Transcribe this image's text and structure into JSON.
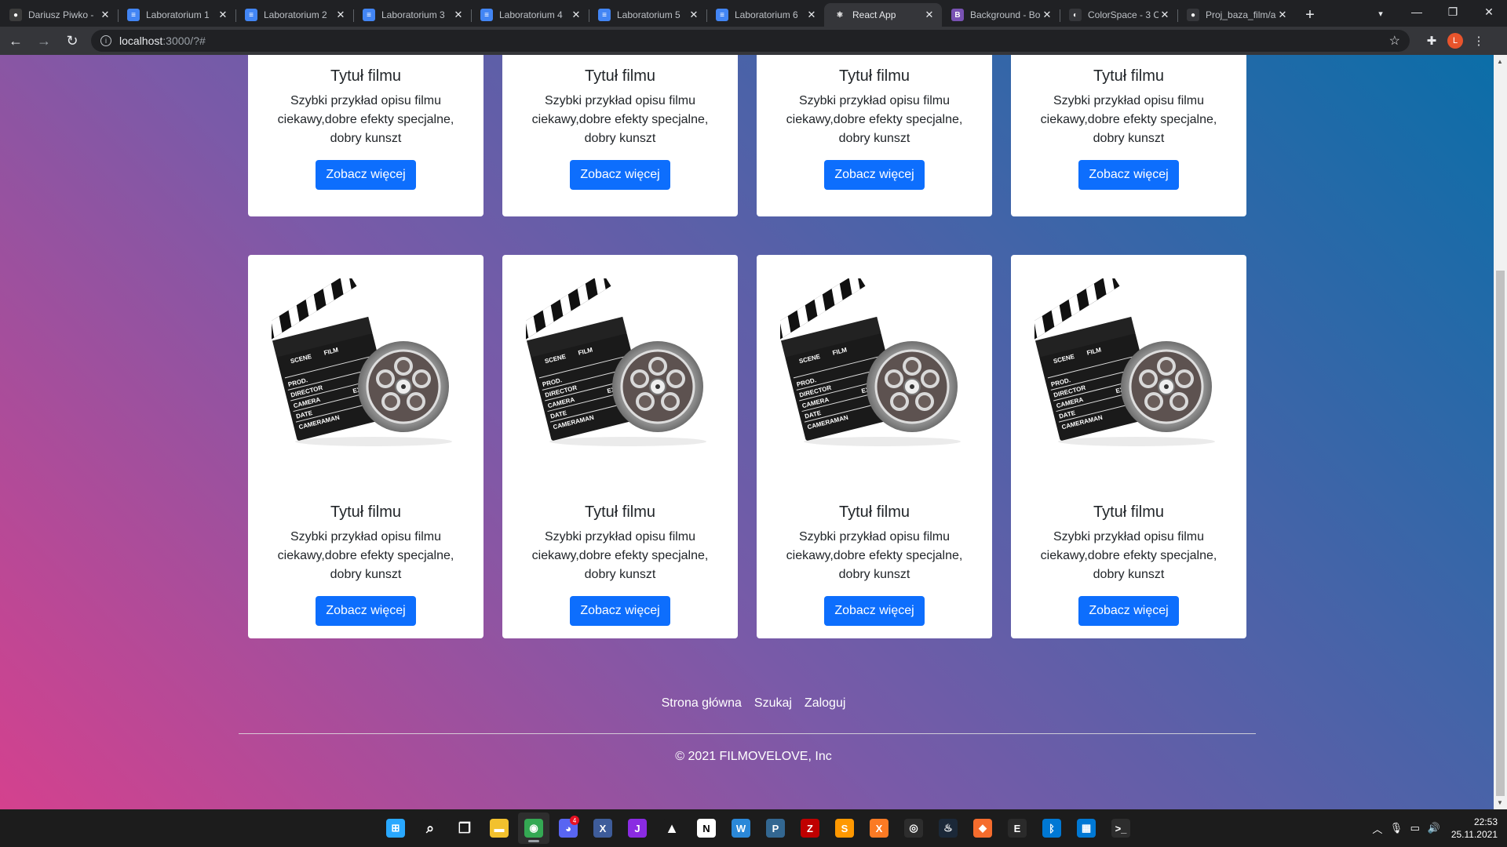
{
  "browser": {
    "tabs": [
      {
        "title": "Dariusz Piwko -",
        "favicon_color": "#3c3c3c",
        "favicon_glyph": "●"
      },
      {
        "title": "Laboratorium 1",
        "favicon_color": "#4285f4",
        "favicon_glyph": "≡"
      },
      {
        "title": "Laboratorium 2",
        "favicon_color": "#4285f4",
        "favicon_glyph": "≡"
      },
      {
        "title": "Laboratorium 3",
        "favicon_color": "#4285f4",
        "favicon_glyph": "≡"
      },
      {
        "title": "Laboratorium 4",
        "favicon_color": "#4285f4",
        "favicon_glyph": "≡"
      },
      {
        "title": "Laboratorium 5",
        "favicon_color": "#4285f4",
        "favicon_glyph": "≡"
      },
      {
        "title": "Laboratorium 6",
        "favicon_color": "#4285f4",
        "favicon_glyph": "≡"
      },
      {
        "title": "React App",
        "favicon_color": "#35363a",
        "favicon_glyph": "⚛",
        "active": true
      },
      {
        "title": "Background - Bo",
        "favicon_color": "#7952b3",
        "favicon_glyph": "B"
      },
      {
        "title": "ColorSpace - 3 C",
        "favicon_color": "#35363a",
        "favicon_glyph": "◐"
      },
      {
        "title": "Proj_baza_film/a",
        "favicon_color": "#35363a",
        "favicon_glyph": "●"
      }
    ],
    "url_host": "localhost",
    "url_path": ":3000/?#",
    "profile_initial": "L"
  },
  "cards_row1": [
    {
      "title": "Tytuł filmu",
      "description": "Szybki przykład opisu filmu ciekawy,dobre efekty specjalne, dobry kunszt",
      "button": "Zobacz więcej"
    },
    {
      "title": "Tytuł filmu",
      "description": "Szybki przykład opisu filmu ciekawy,dobre efekty specjalne, dobry kunszt",
      "button": "Zobacz więcej"
    },
    {
      "title": "Tytuł filmu",
      "description": "Szybki przykład opisu filmu ciekawy,dobre efekty specjalne, dobry kunszt",
      "button": "Zobacz więcej"
    },
    {
      "title": "Tytuł filmu",
      "description": "Szybki przykład opisu filmu ciekawy,dobre efekty specjalne, dobry kunszt",
      "button": "Zobacz więcej"
    }
  ],
  "cards_row2": [
    {
      "title": "Tytuł filmu",
      "description": "Szybki przykład opisu filmu ciekawy,dobre efekty specjalne, dobry kunszt",
      "button": "Zobacz więcej"
    },
    {
      "title": "Tytuł filmu",
      "description": "Szybki przykład opisu filmu ciekawy,dobre efekty specjalne, dobry kunszt",
      "button": "Zobacz więcej"
    },
    {
      "title": "Tytuł filmu",
      "description": "Szybki przykład opisu filmu ciekawy,dobre efekty specjalne, dobry kunszt",
      "button": "Zobacz więcej"
    },
    {
      "title": "Tytuł filmu",
      "description": "Szybki przykład opisu filmu ciekawy,dobre efekty specjalne, dobry kunszt",
      "button": "Zobacz więcej"
    }
  ],
  "clapper_labels": {
    "scene": "SCENE",
    "film": "FILM",
    "prod": "PROD.",
    "director": "DIRECTOR",
    "camera": "CAMERA",
    "date": "DATE",
    "cameraman": "CAMERAMAN",
    "ext": "EXT."
  },
  "footer": {
    "links": [
      "Strona główna",
      "Szukaj",
      "Zaloguj"
    ],
    "copyright": "© 2021 FILMOVELOVE, Inc"
  },
  "taskbar": {
    "apps": [
      {
        "name": "windows-start",
        "color": "#29a8ff",
        "glyph": "⊞"
      },
      {
        "name": "search",
        "color": "#1c1c1c",
        "glyph": "⌕"
      },
      {
        "name": "task-view",
        "color": "#1c1c1c",
        "glyph": "❐"
      },
      {
        "name": "file-explorer",
        "color": "#f2c12e",
        "glyph": "▬"
      },
      {
        "name": "chrome",
        "color": "#34a853",
        "glyph": "◉",
        "active": true
      },
      {
        "name": "discord",
        "color": "#5865f2",
        "glyph": "◕",
        "badge": "4"
      },
      {
        "name": "visual-studio",
        "color": "#3e5c9a",
        "glyph": "X"
      },
      {
        "name": "jetbrains",
        "color": "#8a2be2",
        "glyph": "J"
      },
      {
        "name": "matlab",
        "color": "#1c1c1c",
        "glyph": "▲"
      },
      {
        "name": "notion",
        "color": "#ffffff",
        "glyph": "N"
      },
      {
        "name": "app-w",
        "color": "#2b88d8",
        "glyph": "W"
      },
      {
        "name": "postgres",
        "color": "#336791",
        "glyph": "P"
      },
      {
        "name": "filezilla",
        "color": "#bf0000",
        "glyph": "Z"
      },
      {
        "name": "sublime",
        "color": "#ff9800",
        "glyph": "S"
      },
      {
        "name": "xampp",
        "color": "#fb7a24",
        "glyph": "X"
      },
      {
        "name": "obs",
        "color": "#2d2d2d",
        "glyph": "◎"
      },
      {
        "name": "steam",
        "color": "#1b2838",
        "glyph": "♨"
      },
      {
        "name": "origin",
        "color": "#f56c2d",
        "glyph": "◆"
      },
      {
        "name": "epic",
        "color": "#2a2a2a",
        "glyph": "E"
      },
      {
        "name": "bluetooth",
        "color": "#0078d4",
        "glyph": "ᛒ"
      },
      {
        "name": "store",
        "color": "#0078d4",
        "glyph": "▦"
      },
      {
        "name": "terminal",
        "color": "#2d2d2d",
        "glyph": ">_"
      }
    ],
    "time": "22:53",
    "date": "25.11.2021"
  }
}
